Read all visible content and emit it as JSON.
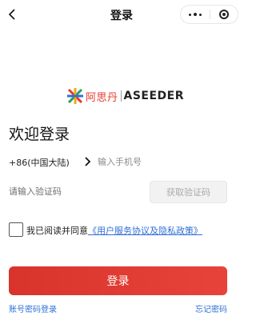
{
  "nav": {
    "title": "登录",
    "back_icon": "chevron-left-icon",
    "more_icon": "more-dots-icon",
    "close_icon": "miniapp-close-icon"
  },
  "logo": {
    "cn_text": "阿思丹",
    "en_text": "ASEEDER",
    "brand_color": "#e8382f"
  },
  "heading": "欢迎登录",
  "phone": {
    "country_code": "+86(中国大陆)",
    "placeholder": "输入手机号",
    "value": ""
  },
  "code": {
    "placeholder": "请输入验证码",
    "value": "",
    "get_code_label": "获取验证码"
  },
  "agreement": {
    "checked": false,
    "prefix": "我已阅读并同意",
    "link": "《用户服务协议及隐私政策》"
  },
  "login_button": "登录",
  "links": {
    "password_login": "账号密码登录",
    "forgot_password": "忘记密码"
  },
  "colors": {
    "primary": "#e8433a",
    "link": "#2f6fd6"
  }
}
